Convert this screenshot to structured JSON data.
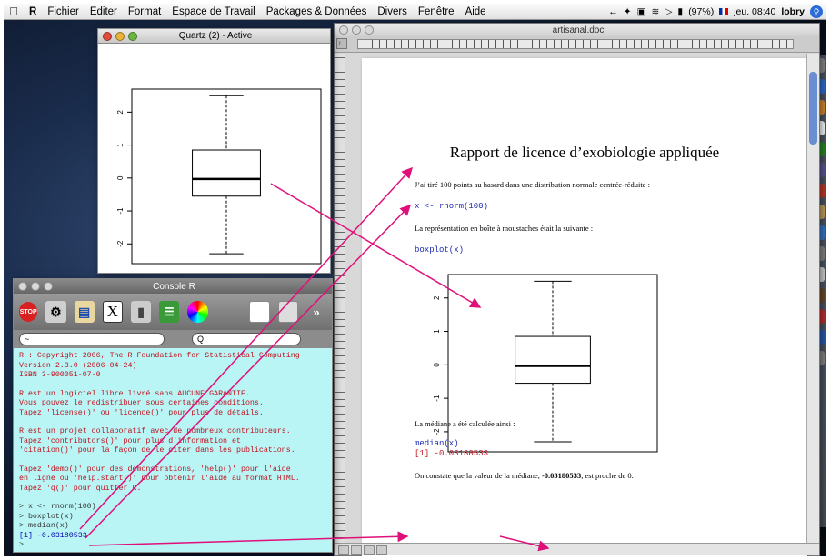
{
  "menubar": {
    "app": "R",
    "items": [
      "Fichier",
      "Editer",
      "Format",
      "Espace de Travail",
      "Packages & Données",
      "Divers",
      "Fenêtre",
      "Aide"
    ],
    "battery": "(97%)",
    "clock": "jeu. 08:40",
    "user": "lobry"
  },
  "quartz_window": {
    "title": "Quartz (2) - Active"
  },
  "boxplot": {
    "yticks": [
      "2",
      "1",
      "0",
      "-1",
      "-2"
    ],
    "stats": {
      "min": -2.3,
      "q1": -0.55,
      "median": -0.03,
      "q3": 0.85,
      "max": 2.5
    },
    "ylim": [
      -2.6,
      2.7
    ]
  },
  "console_window": {
    "title": "Console R",
    "search_left": "~",
    "search_right": "Q",
    "paragraphs": [
      [
        "R : Copyright 2006, The R Foundation for Statistical Computing",
        "Version 2.3.0 (2006-04-24)",
        "ISBN 3-900051-07-0"
      ],
      [
        "R est un logiciel libre livré sans AUCUNE GARANTIE.",
        "Vous pouvez le redistribuer sous certaines conditions.",
        "Tapez 'license()' ou 'licence()' pour plus de détails."
      ],
      [
        "R est un projet collaboratif avec de nombreux contributeurs.",
        "Tapez 'contributors()' pour plus d'information et",
        "'citation()' pour la façon de le citer dans les publications."
      ],
      [
        "Tapez 'demo()' pour des démonstrations, 'help()' pour l'aide",
        "en ligne ou 'help.start()' pour obtenir l'aide au format HTML.",
        "Tapez 'q()' pour quitter R."
      ]
    ],
    "commands": [
      "> x <- rnorm(100)",
      "> boxplot(x)",
      "> median(x)"
    ],
    "output": "[1] -0.03180533",
    "prompt": ">"
  },
  "doc_window": {
    "title": "artisanal.doc",
    "heading": "Rapport de licence d’exobiologie appliquée",
    "p1": "J’ai tiré 100 points au hasard dans une distribution normale centrée-réduite :",
    "code1": "x <- rnorm(100)",
    "p2": "La représentation en boîte à moustaches était la suivante :",
    "code2": "boxplot(x)",
    "p3": "La médiane a été calculée ainsi :",
    "code3": "median(x)",
    "result": "[1] -0.03180533",
    "p4_before": "On constate que la valeur de la médiane, ",
    "p4_value": "-0.03180533",
    "p4_after": ", est proche de 0."
  },
  "colors": {
    "console_bg": "#b9f5f5",
    "console_text": "#c0121e",
    "code_blue": "#1a2ab0",
    "arrow": "#e0107a"
  }
}
